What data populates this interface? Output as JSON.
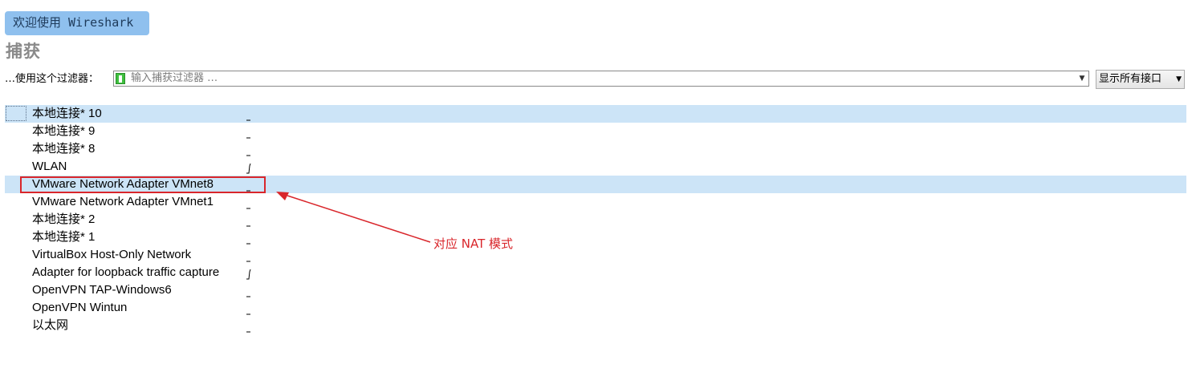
{
  "welcome_button": "欢迎使用 Wireshark",
  "capture_section": {
    "title": "捕获",
    "filter_label": "…使用这个过滤器：",
    "filter_placeholder": "输入捕获过滤器 …",
    "interface_select": "显示所有接口"
  },
  "interfaces": [
    {
      "name": "本地连接* 10",
      "selected": true
    },
    {
      "name": "本地连接* 9"
    },
    {
      "name": "本地连接* 8"
    },
    {
      "name": "WLAN"
    },
    {
      "name": "VMware Network Adapter VMnet8",
      "highlighted": true
    },
    {
      "name": "VMware Network Adapter VMnet1"
    },
    {
      "name": "本地连接* 2"
    },
    {
      "name": "本地连接* 1"
    },
    {
      "name": "VirtualBox Host-Only Network"
    },
    {
      "name": "Adapter for loopback traffic capture"
    },
    {
      "name": "OpenVPN TAP-Windows6"
    },
    {
      "name": "OpenVPN Wintun"
    },
    {
      "name": "以太网"
    }
  ],
  "annotation": {
    "text": "对应 NAT 模式",
    "color": "#d9262b"
  },
  "colors": {
    "selection": "#cce4f7",
    "welcome_bg": "#8fc0ee",
    "filter_bookmark": "#3fbf3f"
  },
  "icons": {
    "filter_bookmark": "bookmark-icon",
    "dropdown": "chevron-down-icon"
  }
}
